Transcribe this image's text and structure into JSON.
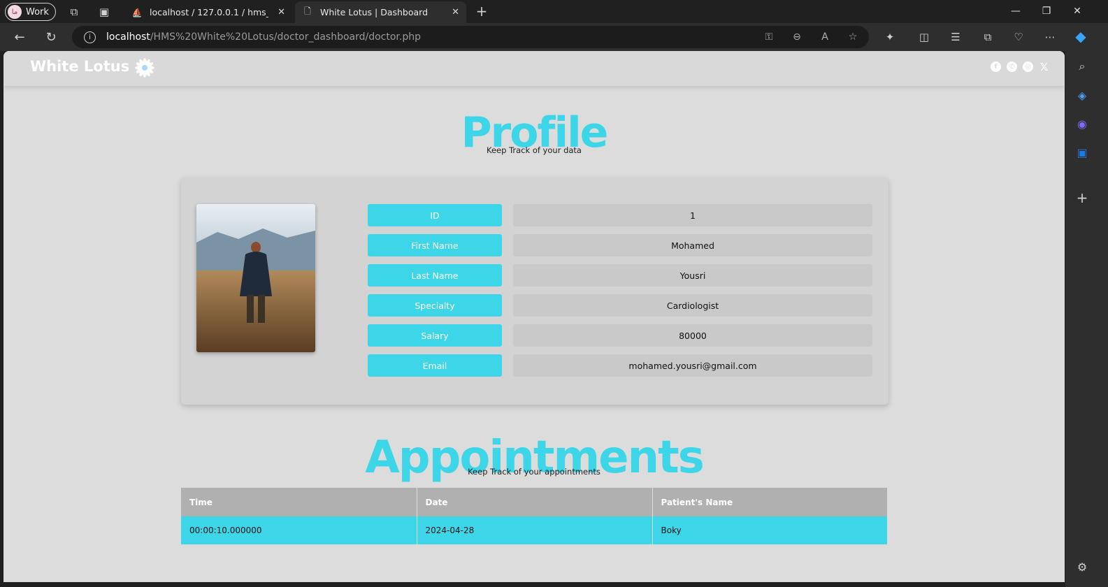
{
  "browser": {
    "profile_label": "Work",
    "profile_initials": "ما",
    "tabs": [
      {
        "title": "localhost / 127.0.0.1 / hms_white",
        "active": false
      },
      {
        "title": "White Lotus | Dashboard",
        "active": true
      }
    ],
    "url_host": "localhost",
    "url_path": "/HMS%20White%20Lotus/doctor_dashboard/doctor.php"
  },
  "site": {
    "brand": "White Lotus",
    "social_icons": [
      "facebook-icon",
      "whatsapp-icon",
      "instagram-icon",
      "x-icon"
    ]
  },
  "profile": {
    "title": "Profile",
    "subtitle": "Keep Track of your data",
    "fields": [
      {
        "label": "ID",
        "value": "1"
      },
      {
        "label": "First Name",
        "value": "Mohamed"
      },
      {
        "label": "Last Name",
        "value": "Yousri"
      },
      {
        "label": "Specialty",
        "value": "Cardiologist"
      },
      {
        "label": "Salary",
        "value": "80000"
      },
      {
        "label": "Email",
        "value": "mohamed.yousri@gmail.com"
      }
    ]
  },
  "appointments": {
    "title": "Appointments",
    "subtitle": "Keep Track of your appointments",
    "columns": [
      "Time",
      "Date",
      "Patient's Name"
    ],
    "rows": [
      [
        "00:00:10.000000",
        "2024-04-28",
        "Boky"
      ]
    ]
  },
  "colors": {
    "accent": "#3dd6e8",
    "page_bg": "#dcdcdc",
    "card_bg": "#d3d3d3",
    "value_bg": "#c9c9c9",
    "table_header": "#b0b0b0"
  }
}
